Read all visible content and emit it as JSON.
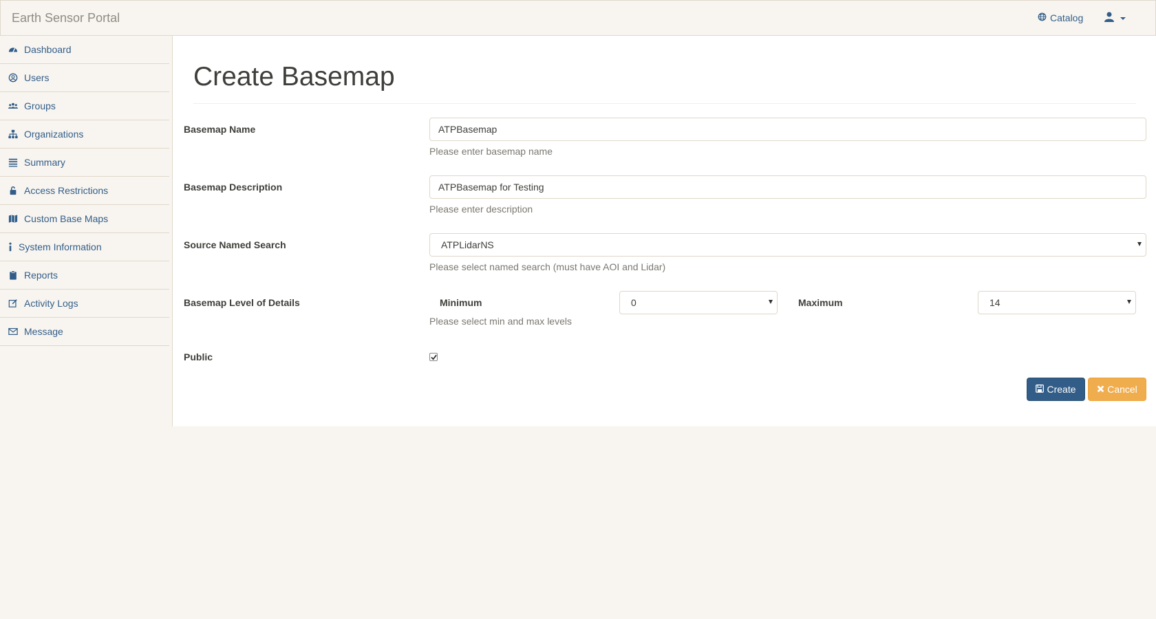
{
  "app": {
    "title": "Earth Sensor Portal"
  },
  "header": {
    "catalog_label": "Catalog",
    "user_icon": "user-icon"
  },
  "sidebar": {
    "items": [
      {
        "label": "Dashboard",
        "icon": "dashboard-icon"
      },
      {
        "label": "Users",
        "icon": "user-circle-icon"
      },
      {
        "label": "Groups",
        "icon": "groups-icon"
      },
      {
        "label": "Organizations",
        "icon": "sitemap-icon"
      },
      {
        "label": "Summary",
        "icon": "list-icon"
      },
      {
        "label": "Access Restrictions",
        "icon": "unlock-icon"
      },
      {
        "label": "Custom Base Maps",
        "icon": "map-icon"
      },
      {
        "label": "System Information",
        "icon": "info-icon"
      },
      {
        "label": "Reports",
        "icon": "clipboard-icon"
      },
      {
        "label": "Activity Logs",
        "icon": "edit-icon"
      },
      {
        "label": "Message",
        "icon": "envelope-icon"
      }
    ]
  },
  "page": {
    "title": "Create Basemap"
  },
  "form": {
    "name": {
      "label": "Basemap Name",
      "value": "ATPBasemap",
      "help": "Please enter basemap name"
    },
    "description": {
      "label": "Basemap Description",
      "value": "ATPBasemap for Testing",
      "help": "Please enter description"
    },
    "source": {
      "label": "Source Named Search",
      "value": "ATPLidarNS",
      "help": "Please select named search (must have AOI and Lidar)"
    },
    "lod": {
      "label": "Basemap Level of Details",
      "min_label": "Minimum",
      "min_value": "0",
      "max_label": "Maximum",
      "max_value": "14",
      "help": "Please select min and max levels"
    },
    "public": {
      "label": "Public",
      "checked": true
    },
    "create_label": "Create",
    "cancel_label": "Cancel"
  },
  "colors": {
    "primary": "#325d88",
    "warning": "#f0ad4e",
    "background": "#f8f5f0",
    "border": "#dfd7ca"
  }
}
